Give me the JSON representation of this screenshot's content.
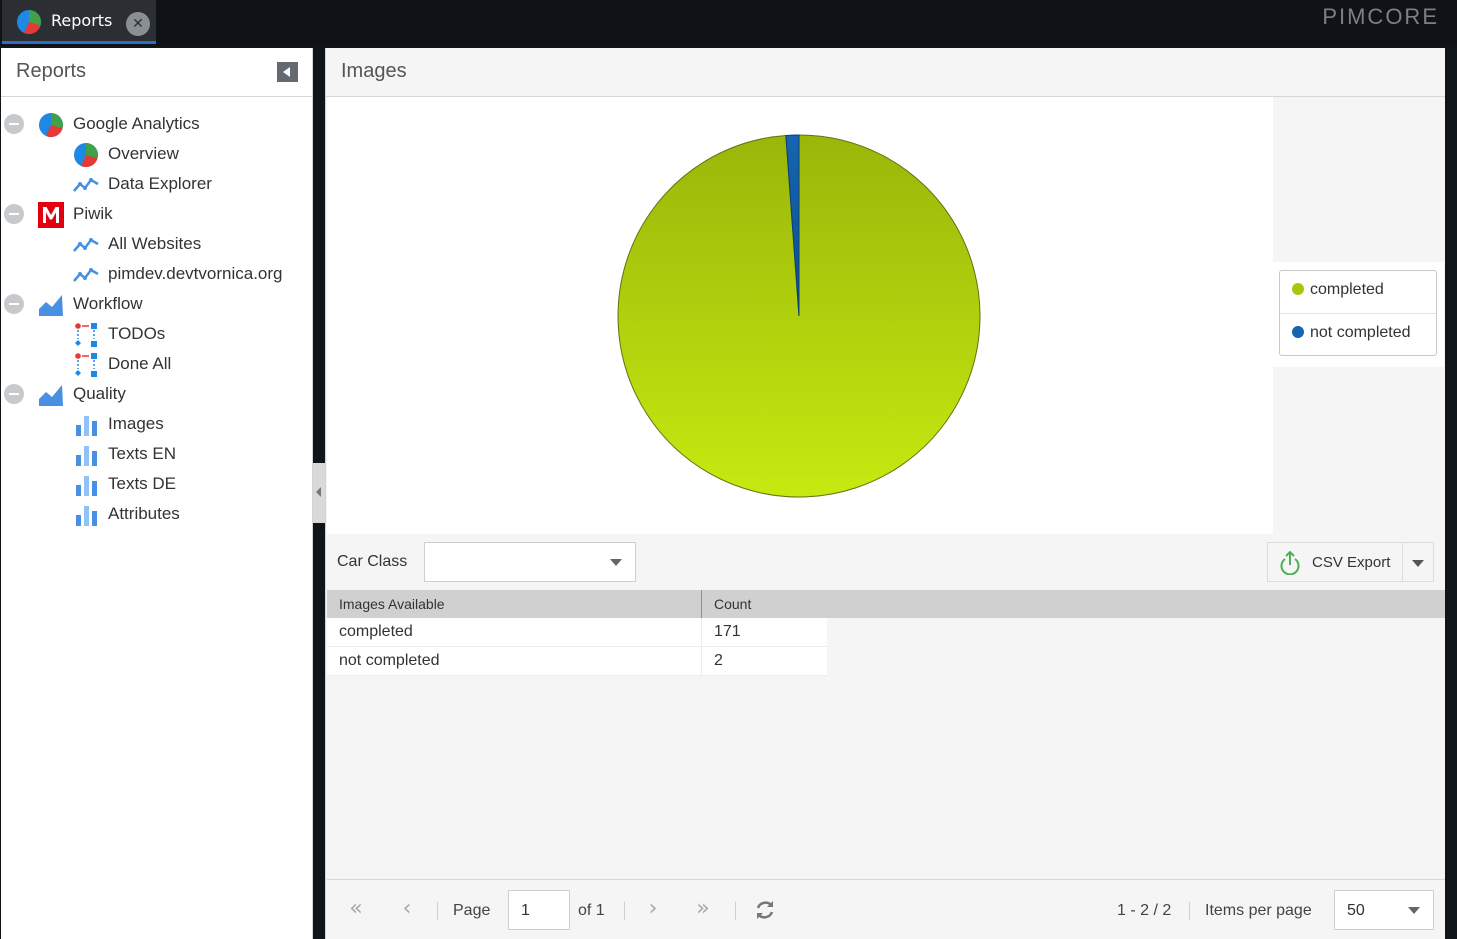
{
  "tabbar": {
    "tab_label": "Reports",
    "brand": "PIMCORE"
  },
  "sidebar": {
    "title": "Reports",
    "groups": [
      {
        "label": "Google Analytics",
        "icon": "google-analytics-icon",
        "children": [
          {
            "label": "Overview",
            "icon": "pie-chart-icon"
          },
          {
            "label": "Data Explorer",
            "icon": "line-chart-icon"
          }
        ]
      },
      {
        "label": "Piwik",
        "icon": "piwik-icon",
        "children": [
          {
            "label": "All Websites",
            "icon": "line-chart-icon"
          },
          {
            "label": "pimdev.devtvornica.org",
            "icon": "line-chart-icon"
          }
        ]
      },
      {
        "label": "Workflow",
        "icon": "area-chart-icon",
        "children": [
          {
            "label": "TODOs",
            "icon": "workflow-icon"
          },
          {
            "label": "Done All",
            "icon": "workflow-icon"
          }
        ]
      },
      {
        "label": "Quality",
        "icon": "area-chart-icon",
        "children": [
          {
            "label": "Images",
            "icon": "bar-chart-icon"
          },
          {
            "label": "Texts EN",
            "icon": "bar-chart-icon"
          },
          {
            "label": "Texts DE",
            "icon": "bar-chart-icon"
          },
          {
            "label": "Attributes",
            "icon": "bar-chart-icon"
          }
        ]
      }
    ]
  },
  "main": {
    "title": "Images",
    "filter_label": "Car Class",
    "filter_value": "",
    "csv_export_label": "CSV Export"
  },
  "chart_data": {
    "type": "pie",
    "categories": [
      "completed",
      "not completed"
    ],
    "values": [
      171,
      2
    ],
    "colors": [
      "#a8c70c",
      "#1565b0"
    ],
    "legend_position": "right"
  },
  "grid": {
    "columns": [
      "Images Available",
      "Count"
    ],
    "rows": [
      [
        "completed",
        "171"
      ],
      [
        "not completed",
        "2"
      ]
    ]
  },
  "pager": {
    "page_label": "Page",
    "page_value": "1",
    "of_label": "of 1",
    "range_label": "1 - 2 / 2",
    "items_per_page_label": "Items per page",
    "items_per_page_value": "50"
  },
  "colors": {
    "accent": "#2f6dbf",
    "pie_completed": "#a8c70c",
    "pie_not_completed": "#1565b0"
  }
}
